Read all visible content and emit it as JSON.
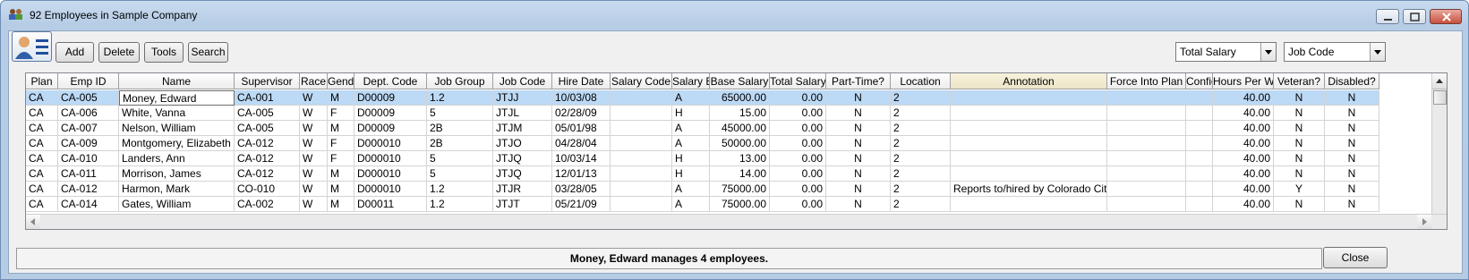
{
  "window": {
    "title": "92 Employees in Sample Company"
  },
  "toolbar": {
    "add_label": "Add",
    "delete_label": "Delete",
    "tools_label": "Tools",
    "search_label": "Search",
    "select1_value": "Total Salary",
    "select2_value": "Job Code"
  },
  "grid": {
    "columns": [
      "Plan",
      "Emp ID",
      "Name",
      "Supervisor",
      "Race",
      "Gender",
      "Dept. Code",
      "Job Group",
      "Job Code",
      "Hire Date",
      "Salary Code",
      "Salary Basis",
      "Base Salary",
      "Total Salary",
      "Part-Time?",
      "Location",
      "Annotation",
      "Force Into Plan",
      "Confidential",
      "Hours Per Week",
      "Veteran?",
      "Disabled?"
    ],
    "rows": [
      [
        "CA",
        "CA-005",
        "Money, Edward",
        "CA-001",
        "W",
        "M",
        "D00009",
        "1.2",
        "JTJJ",
        "10/03/08",
        "",
        "A",
        "65000.00",
        "0.00",
        "N",
        "2",
        "",
        "",
        "",
        "40.00",
        "N",
        "N"
      ],
      [
        "CA",
        "CA-006",
        "White, Vanna",
        "CA-005",
        "W",
        "F",
        "D00009",
        "5",
        "JTJL",
        "02/28/09",
        "",
        "H",
        "15.00",
        "0.00",
        "N",
        "2",
        "",
        "",
        "",
        "40.00",
        "N",
        "N"
      ],
      [
        "CA",
        "CA-007",
        "Nelson, William",
        "CA-005",
        "W",
        "M",
        "D00009",
        "2B",
        "JTJM",
        "05/01/98",
        "",
        "A",
        "45000.00",
        "0.00",
        "N",
        "2",
        "",
        "",
        "",
        "40.00",
        "N",
        "N"
      ],
      [
        "CA",
        "CA-009",
        "Montgomery, Elizabeth",
        "CA-012",
        "W",
        "F",
        "D000010",
        "2B",
        "JTJO",
        "04/28/04",
        "",
        "A",
        "50000.00",
        "0.00",
        "N",
        "2",
        "",
        "",
        "",
        "40.00",
        "N",
        "N"
      ],
      [
        "CA",
        "CA-010",
        "Landers, Ann",
        "CA-012",
        "W",
        "F",
        "D000010",
        "5",
        "JTJQ",
        "10/03/14",
        "",
        "H",
        "13.00",
        "0.00",
        "N",
        "2",
        "",
        "",
        "",
        "40.00",
        "N",
        "N"
      ],
      [
        "CA",
        "CA-011",
        "Morrison, James",
        "CA-012",
        "W",
        "M",
        "D000010",
        "5",
        "JTJQ",
        "12/01/13",
        "",
        "H",
        "14.00",
        "0.00",
        "N",
        "2",
        "",
        "",
        "",
        "40.00",
        "N",
        "N"
      ],
      [
        "CA",
        "CA-012",
        "Harmon, Mark",
        "CO-010",
        "W",
        "M",
        "D000010",
        "1.2",
        "JTJR",
        "03/28/05",
        "",
        "A",
        "75000.00",
        "0.00",
        "N",
        "2",
        "Reports to/hired by Colorado City",
        "",
        "",
        "40.00",
        "Y",
        "N"
      ],
      [
        "CA",
        "CA-014",
        "Gates, William",
        "CA-002",
        "W",
        "M",
        "D00011",
        "1.2",
        "JTJT",
        "05/21/09",
        "",
        "A",
        "75000.00",
        "0.00",
        "N",
        "2",
        "",
        "",
        "",
        "40.00",
        "N",
        "N"
      ]
    ]
  },
  "status": {
    "message": "Money, Edward manages 4 employees."
  },
  "close_label": "Close"
}
